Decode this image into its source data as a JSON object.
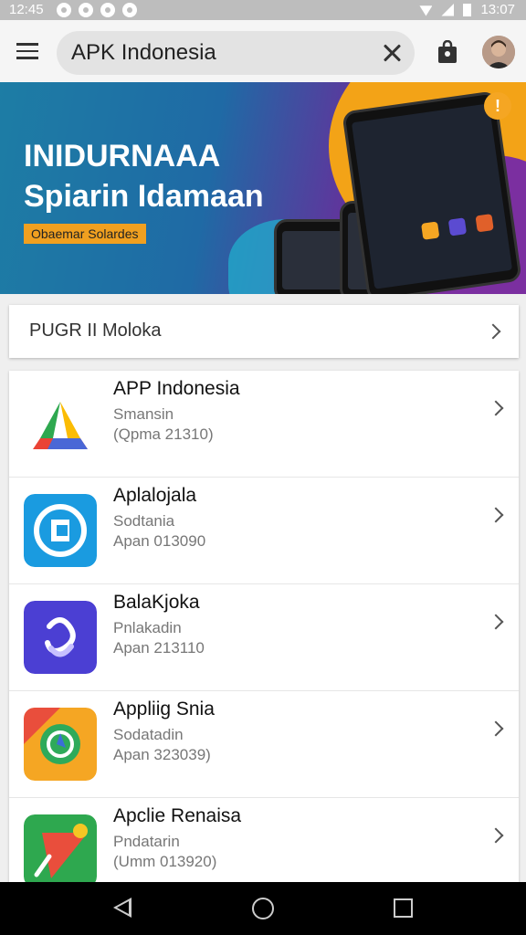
{
  "status_bar": {
    "time": "12:45",
    "clock_right": "13:07"
  },
  "search": {
    "value": "APK Indonesia"
  },
  "banner": {
    "title_line1": "INIDURNAAA",
    "title_line2": "Spiarin Idamaan",
    "button_label": "Obaemar Solardes",
    "colors": {
      "blue": "#1d7da5",
      "orange": "#f3a317",
      "purple": "#7b2fa0"
    }
  },
  "section": {
    "label": "PUGR II Moloka"
  },
  "apps": [
    {
      "name": "APP Indonesia",
      "subtitle": "Smansin",
      "version": "(Qpma 21310)",
      "icon": "drive-triangle-icon"
    },
    {
      "name": "Aplalojala",
      "subtitle": "Sodtania",
      "version": "Apan 013090",
      "icon": "blue-ring-icon"
    },
    {
      "name": "BalaKjoka",
      "subtitle": "Pnlakadin",
      "version": "Apan 213110",
      "icon": "purple-loop-icon"
    },
    {
      "name": "Appliig Snia",
      "subtitle": "Sodatadin",
      "version": "Apan 323039)",
      "icon": "compass-circle-icon"
    },
    {
      "name": "Apclie Renaisa",
      "subtitle": "Pndatarin",
      "version": "(Umm 013920)",
      "icon": "green-kite-icon"
    }
  ]
}
